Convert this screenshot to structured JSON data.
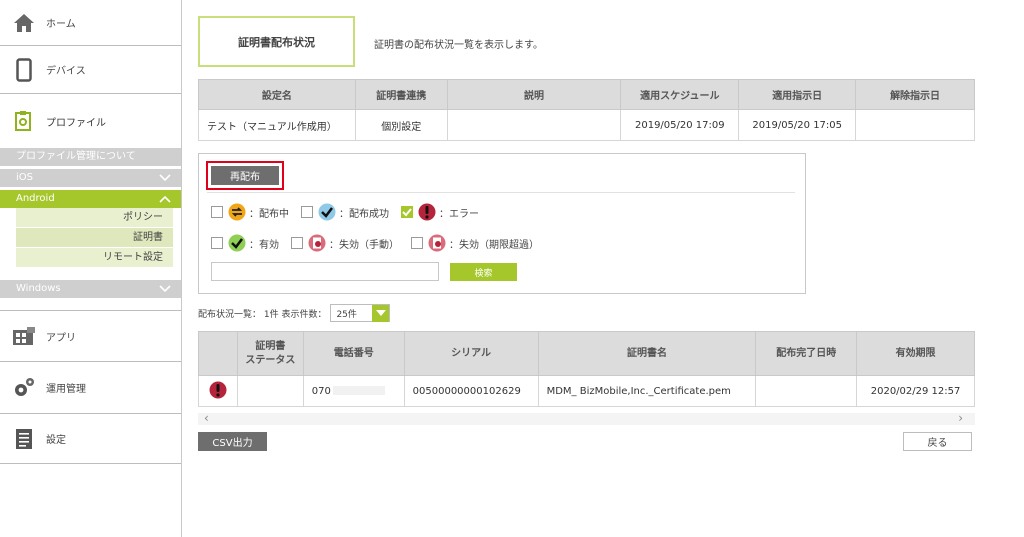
{
  "sidebar": {
    "nav": {
      "home": {
        "label": "ホーム",
        "icon": "home-icon"
      },
      "devices": {
        "label": "デバイス",
        "icon": "device-icon"
      },
      "profile": {
        "label": "プロファイル",
        "icon": "profile-icon"
      },
      "apps": {
        "label": "アプリ",
        "icon": "apps-icon"
      },
      "operations": {
        "label": "運用管理",
        "icon": "gear-icon"
      },
      "settings": {
        "label": "設定",
        "icon": "settings-icon"
      }
    },
    "profile_menu": {
      "about": "プロファイル管理について",
      "ios": "iOS",
      "android": "Android",
      "android_items": [
        "ポリシー",
        "証明書",
        "リモート設定"
      ],
      "windows": "Windows"
    }
  },
  "page": {
    "title": "証明書配布状況",
    "description": "証明書の配布状況一覧を表示します。"
  },
  "profile_table": {
    "headers": [
      "設定名",
      "証明書連携",
      "説明",
      "適用スケジュール",
      "適用指示日",
      "解除指示日"
    ],
    "row": [
      "テスト（マニュアル作成用）",
      "個別設定",
      "",
      "2019/05/20 17:09",
      "2019/05/20 17:05",
      ""
    ]
  },
  "filter": {
    "redistribute_label": "再配布",
    "statuses": [
      {
        "label": "：配布中",
        "checked": false,
        "icon": "distributing-icon"
      },
      {
        "label": "：配布成功",
        "checked": false,
        "icon": "success-check-icon"
      },
      {
        "label": "：エラー",
        "checked": true,
        "icon": "error-icon"
      },
      {
        "label": "：有効",
        "checked": false,
        "icon": "valid-check-icon"
      },
      {
        "label": "：失効（手動）",
        "checked": false,
        "icon": "revoked-manual-icon"
      },
      {
        "label": "：失効（期限超過）",
        "checked": false,
        "icon": "revoked-expired-icon"
      }
    ],
    "search_value": "",
    "search_label": "検索"
  },
  "list": {
    "count_text": "配布状況一覧： 1件 表示件数：",
    "per_page": "25件"
  },
  "cert_table": {
    "headers": {
      "status_line1": "証明書",
      "status_line2": "ステータス",
      "phone": "電話番号",
      "serial": "シリアル",
      "cert_name": "証明書名",
      "completed": "配布完了日時",
      "expiry": "有効期限"
    },
    "row": {
      "status_icon": "error-icon",
      "status": "",
      "phone": "070",
      "serial": "00500000000102629",
      "cert_name": "MDM_ BizMobile,Inc._Certificate.pem",
      "completed": "",
      "expiry": "2020/02/29 12:57"
    }
  },
  "footer": {
    "csv_label": "CSV出力",
    "back_label": "戻る"
  },
  "colors": {
    "accent": "#a5c72b",
    "highlight": "#e1001a",
    "button_dark": "#6e6e6e"
  }
}
